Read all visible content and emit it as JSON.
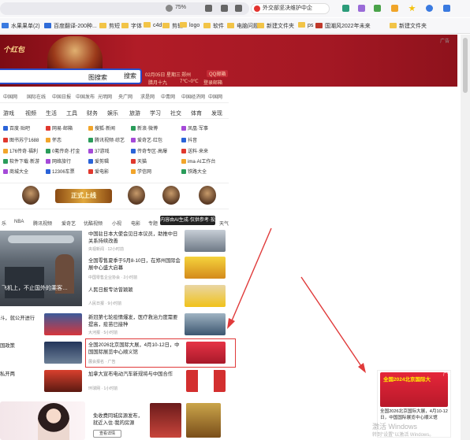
{
  "browser": {
    "zoom": "75%",
    "tab_search_text": "外交部坚决维护中企",
    "colors": {
      "toolbar_bg": "#f7f7f9",
      "accent_red": "#e03a3a"
    }
  },
  "bookmarks": [
    {
      "label": "水果果单(2)",
      "icon": "site-icon"
    },
    {
      "label": "百度翻译-200种...",
      "icon": "site-icon"
    },
    {
      "label": "剪短",
      "icon": "folder-icon"
    },
    {
      "label": "字体",
      "icon": "folder-icon"
    },
    {
      "label": "c4d",
      "icon": "folder-icon"
    },
    {
      "label": "剪辑",
      "icon": "folder-icon"
    },
    {
      "label": "logo",
      "icon": "folder-icon"
    },
    {
      "label": "软件",
      "icon": "folder-icon"
    },
    {
      "label": "电脑问题",
      "icon": "folder-icon"
    },
    {
      "label": "新建文件夹",
      "icon": "folder-icon"
    },
    {
      "label": "ps",
      "icon": "folder-icon"
    },
    {
      "label": "国潮风2022年未来",
      "icon": "site-icon"
    },
    {
      "label": "新建文件夹",
      "icon": "folder-icon"
    }
  ],
  "banner": {
    "title": "个红包",
    "ad_tag": "广告",
    "search_image_label": "图搜索",
    "search_button": "搜索",
    "date": "02月05日 星期三",
    "lunar": "腊月十九",
    "city": "郑州",
    "weather": "7℃~0℃",
    "mail": "QQ邮箱",
    "mail_sub": "登录邮箱"
  },
  "top_nav": [
    "中国网",
    "国际在线",
    "中国日报",
    "中国发布",
    "光明网",
    "央广网",
    "求是网",
    "中青网",
    "中国经济网",
    "中国网"
  ],
  "categories": [
    "游戏",
    "视频",
    "生活",
    "工具",
    "财务",
    "娱乐",
    "旅游",
    "学习",
    "社交",
    "体育",
    "发现"
  ],
  "sites": [
    [
      "百度·贴吧",
      "网易·邮箱",
      "搜狐·新闻",
      "新浪·微博",
      "凤凰·军事"
    ],
    [
      "图书苏宁1688",
      "怀恋",
      "腾讯视频·综艺",
      "爱奇艺·红包",
      "抖音"
    ],
    [
      "176传奇·福利",
      "0氪传奇·打金",
      "37游戏",
      "传奇专区·高爆",
      "送料·来来"
    ],
    [
      "软件下载·新游",
      "网络旅行",
      "爱剪辑",
      "天猫",
      "ima·AI工作台"
    ],
    [
      "商城大全",
      "12306车票",
      "爱电影",
      "学信网",
      "铁路大全"
    ]
  ],
  "game_strip": {
    "logo_text": "正式上线"
  },
  "news_tabs": [
    "乐",
    "NBA",
    "腾讯视频",
    "爱奇艺",
    "优酷视频",
    "小视",
    "电影",
    "专题",
    "天气"
  ],
  "tooltip": "内容由AI生成·仅供参考·投诉",
  "hero": {
    "caption": "飞机上，不止国外的乘客…"
  },
  "left_snippets": [
    "斗，就公开进行",
    "国政策",
    "私开两"
  ],
  "news": [
    {
      "title": "中国驻日本大使会见日本议员，助推中日关系持续改善",
      "meta": "央视新闻 · 12小时前"
    },
    {
      "title": "全国零售夏季于5月8-10日，在郑州国际会展中心盛大启幕",
      "meta": "中国零售企业协会 · 2小时前"
    },
    {
      "title": "人民日报专访曾颖颖",
      "meta": "人民日报 · 9小时前"
    },
    {
      "title": "新冠第七轮疫情爆发，医疗救治力度需要提高，疫苗已接种",
      "meta": "大河报 · 5小时前"
    },
    {
      "title": "全国2026北京国际大展，4月10-12日，中国国际展览中心顺义馆",
      "meta": "展会报名 · 广告"
    },
    {
      "title": "加拿大宣布电动汽车新规将与中国合作",
      "meta": "环球网 · 1小时前"
    }
  ],
  "bottom": {
    "ad_text": "免收费同城房源发布，就近入住·我的房源",
    "button": "查看详情"
  },
  "side_ad": {
    "tag": "广告",
    "headline": "全国2024北京国际大",
    "text": "全国2026北京国际大展，4月10-12日，中国国际展览中心顺义馆"
  },
  "watermark": {
    "line1": "激活 Windows",
    "line2": "转到\"设置\"以激活 Windows。"
  }
}
